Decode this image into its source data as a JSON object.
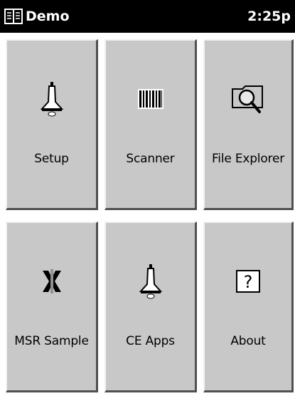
{
  "titlebar": {
    "title": "Demo",
    "time": "2:25p",
    "app_icon": "book-icon"
  },
  "tiles": [
    {
      "label": "Setup",
      "icon": "bell-icon"
    },
    {
      "label": "Scanner",
      "icon": "barcode-icon"
    },
    {
      "label": "File Explorer",
      "icon": "magnifier-folder-icon"
    },
    {
      "label": "MSR Sample",
      "icon": "card-swipe-icon"
    },
    {
      "label": "CE Apps",
      "icon": "bell-icon"
    },
    {
      "label": "About",
      "icon": "question-icon"
    }
  ],
  "colors": {
    "titlebar_bg": "#000000",
    "tile_face": "#c8c8c8",
    "tile_shadow": "#505050",
    "tile_highlight": "#f2f2f2"
  }
}
